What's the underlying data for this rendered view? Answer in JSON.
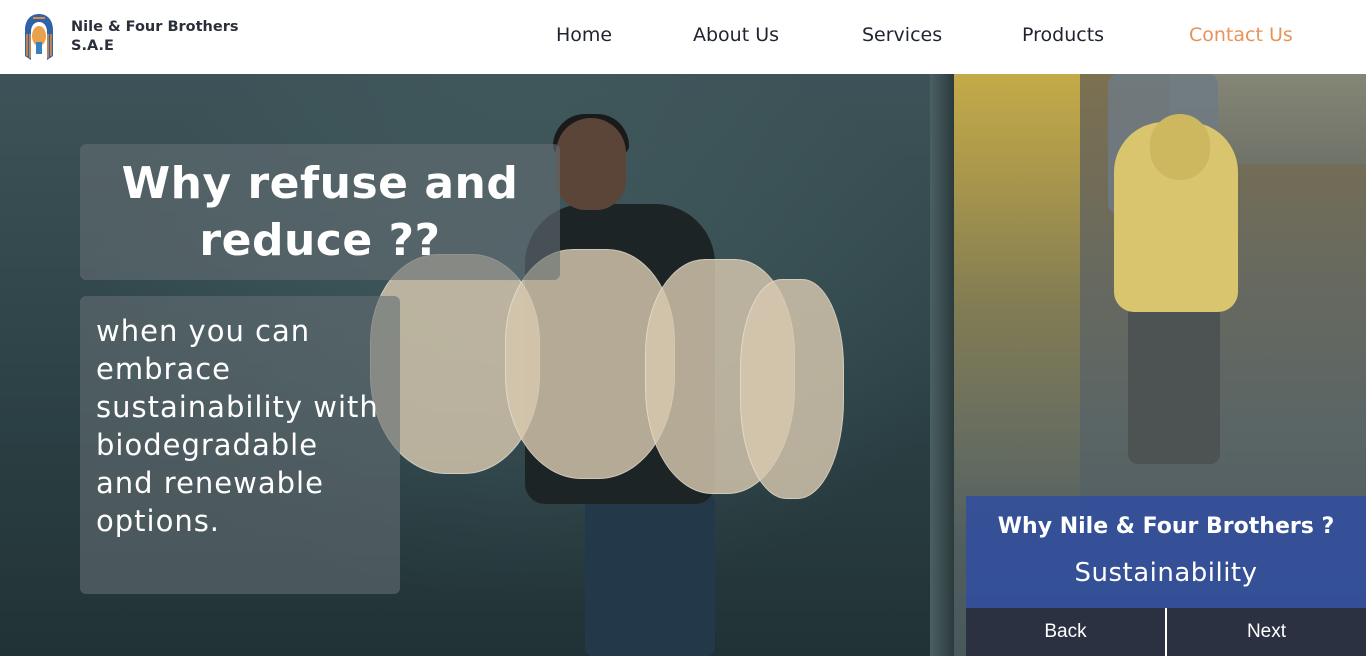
{
  "header": {
    "brand_line1": "Nile & Four Brothers",
    "brand_line2": "S.A.E",
    "logo_icon": "pharaoh-head-icon"
  },
  "nav": {
    "items": [
      {
        "label": "Home"
      },
      {
        "label": "About Us"
      },
      {
        "label": "Services"
      },
      {
        "label": "Products"
      },
      {
        "label": "Contact Us",
        "active": true
      }
    ],
    "active_color": "#e8935a"
  },
  "hero": {
    "title": "Why refuse and reduce ??",
    "body": "when you can embrace sustainability with biodegradable and renewable options."
  },
  "why_card": {
    "title": "Why Nile & Four Brothers ?",
    "subtitle": "Sustainability"
  },
  "buttons": {
    "back_label": "Back",
    "next_label": "Next"
  }
}
